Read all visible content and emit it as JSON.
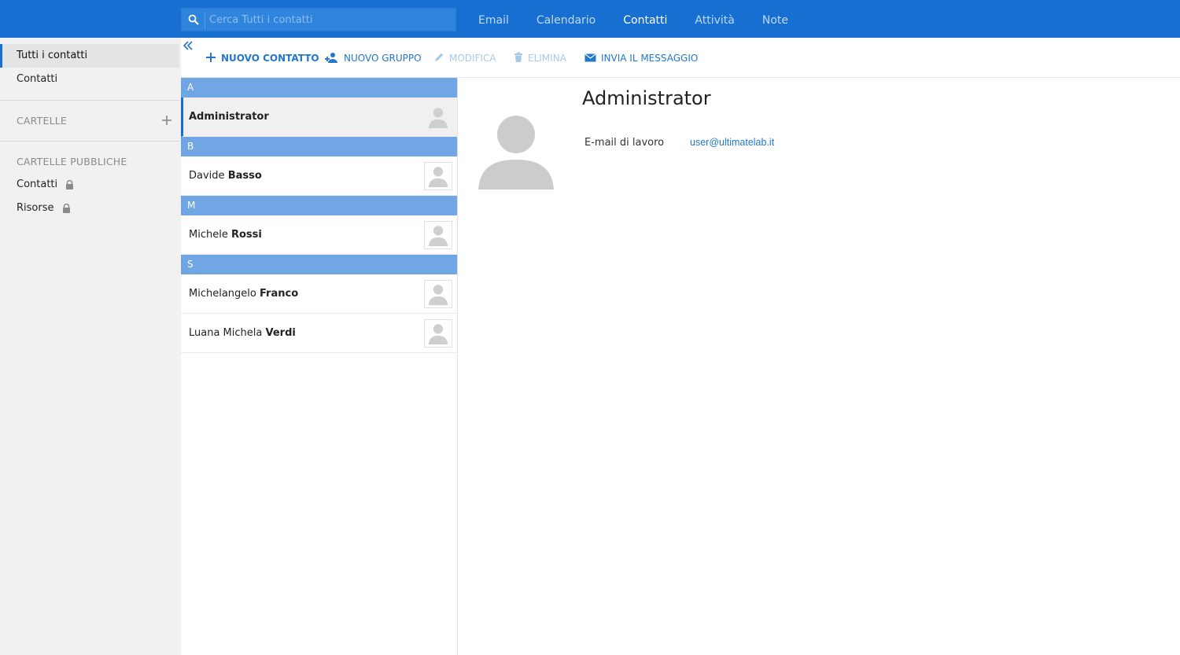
{
  "search": {
    "placeholder": "Cerca Tutti i contatti"
  },
  "nav": [
    {
      "label": "Email",
      "active": false
    },
    {
      "label": "Calendario",
      "active": false
    },
    {
      "label": "Contatti",
      "active": true
    },
    {
      "label": "Attività",
      "active": false
    },
    {
      "label": "Note",
      "active": false
    }
  ],
  "sidebar": {
    "all_contacts": "Tutti i contatti",
    "contacts": "Contatti",
    "folders_heading": "CARTELLE",
    "public_heading": "CARTELLE PUBBLICHE",
    "public_items": [
      {
        "label": "Contatti",
        "icon": "lock-icon"
      },
      {
        "label": "Risorse",
        "icon": "lock-icon"
      }
    ]
  },
  "toolbar": {
    "new_contact": "NUOVO CONTATTO",
    "new_group": "NUOVO GRUPPO",
    "edit": "MODIFICA",
    "delete": "ELIMINA",
    "send_message": "INVIA IL MESSAGGIO"
  },
  "contacts": {
    "groups": [
      {
        "letter": "A",
        "items": [
          {
            "first": "",
            "last": "Administrator",
            "selected": true
          }
        ]
      },
      {
        "letter": "B",
        "items": [
          {
            "first": "Davide",
            "last": "Basso",
            "selected": false
          }
        ]
      },
      {
        "letter": "M",
        "items": [
          {
            "first": "Michele",
            "last": "Rossi",
            "selected": false
          }
        ]
      },
      {
        "letter": "S",
        "items": [
          {
            "first": "Michelangelo",
            "last": "Franco",
            "selected": false
          },
          {
            "first": "Luana Michela",
            "last": "Verdi",
            "selected": false
          }
        ]
      }
    ]
  },
  "detail": {
    "name": "Administrator",
    "email_label": "E-mail di lavoro",
    "email_value": "user@ultimatelab.it"
  },
  "colors": {
    "accent": "#176fd1",
    "group_header": "#6fa6e3",
    "link": "#2277cc"
  }
}
